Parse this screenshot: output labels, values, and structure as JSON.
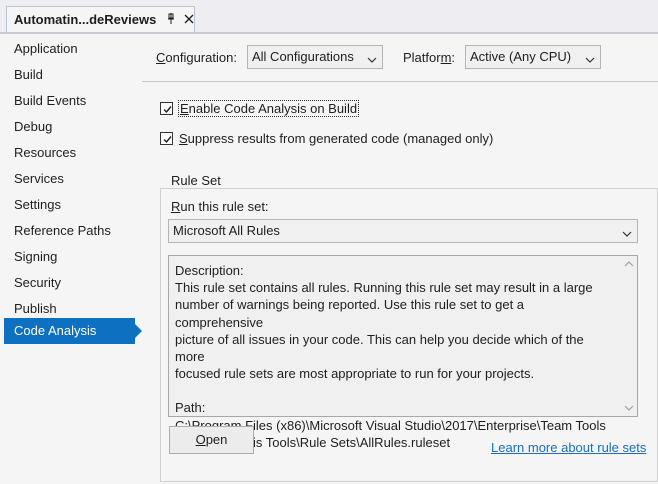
{
  "tab": {
    "title": "Automatin...deReviews",
    "pin_icon": "pin-icon",
    "close_icon": "close-icon"
  },
  "sidebar": {
    "items": [
      {
        "label": "Application"
      },
      {
        "label": "Build"
      },
      {
        "label": "Build Events"
      },
      {
        "label": "Debug"
      },
      {
        "label": "Resources"
      },
      {
        "label": "Services"
      },
      {
        "label": "Settings"
      },
      {
        "label": "Reference Paths"
      },
      {
        "label": "Signing"
      },
      {
        "label": "Security"
      },
      {
        "label": "Publish"
      },
      {
        "label": "Code Analysis",
        "selected": true
      }
    ]
  },
  "config": {
    "configuration_label_pre": "C",
    "configuration_label_post": "onfiguration:",
    "configuration_value": "All Configurations",
    "platform_label_pre": "Platfor",
    "platform_label_mn": "m",
    "platform_label_post": ":",
    "platform_value": "Active (Any CPU)"
  },
  "options": {
    "enable_label_mn": "E",
    "enable_label_rest": "nable Code Analysis on Build",
    "enable_checked": true,
    "suppress_label_mn": "S",
    "suppress_label_rest": "uppress results from generated code (managed only)",
    "suppress_checked": true
  },
  "ruleset": {
    "group_title": "Rule Set",
    "run_label_mn": "R",
    "run_label_rest": "un this rule set:",
    "selected_rule": "Microsoft All Rules",
    "description_lines": [
      "Description:",
      "This rule set contains all rules. Running this rule set may result in a large",
      "number of warnings being reported. Use this rule set to get a comprehensive",
      "picture of all issues in your code. This can help you decide which of the more",
      "focused rule sets are most appropriate to run for your projects.",
      "",
      "Path:",
      "C:\\Program Files (x86)\\Microsoft Visual Studio\\2017\\Enterprise\\Team Tools",
      "\\Static Analysis Tools\\Rule Sets\\AllRules.ruleset"
    ],
    "open_button_mn": "O",
    "open_button_rest": "pen",
    "learn_more_link": "Learn more about rule sets"
  },
  "colors": {
    "accent": "#0e70c0",
    "link": "#1a6dbf",
    "background": "#f5f5f5"
  }
}
